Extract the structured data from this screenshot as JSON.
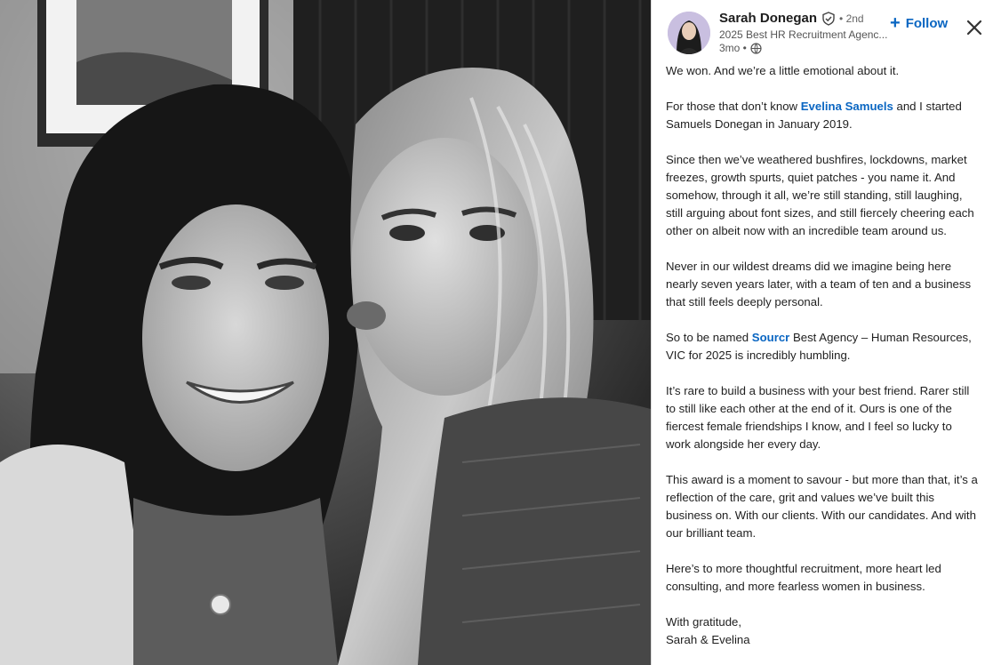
{
  "photo": {
    "alt": "Black and white selfie of two women"
  },
  "author": {
    "name": "Sarah Donegan",
    "degree": "• 2nd",
    "headline": "2025 Best HR Recruitment Agenc...",
    "time": "3mo •"
  },
  "follow": {
    "label": "Follow"
  },
  "icons": {
    "verified": "verified-shield-icon",
    "globe": "globe-icon",
    "close": "close-icon",
    "plus": "plus-icon"
  },
  "colors": {
    "link": "#0a66c2",
    "text": "#1f1f1f",
    "muted": "#666666"
  },
  "post": {
    "p1": "We won. And we’re a little emotional about it.",
    "p2_before": "For those that don’t know ",
    "p2_mention": "Evelina Samuels",
    "p2_after": " and I started Samuels Donegan in January 2019.",
    "p3": "Since then we’ve weathered bushfires, lockdowns, market freezes, growth spurts, quiet patches - you name it. And somehow, through it all, we’re still standing, still laughing, still arguing about font sizes, and still fiercely cheering each other on albeit now with an incredible team around us.",
    "p4": "Never in our wildest dreams did we imagine being here nearly seven years later, with a team of ten and a business that still feels deeply personal.",
    "p5_before": "So to be named ",
    "p5_mention": "Sourcr",
    "p5_after": " Best Agency – Human Resources, VIC for 2025 is incredibly humbling.",
    "p6": "It’s rare to build a business with your best friend. Rarer still to still like each other at the end of it. Ours is one of the fiercest female friendships I know, and I feel so lucky to work alongside her every day.",
    "p7": "This award is a moment to savour - but more than that, it’s a reflection of the care, grit and values we’ve built this business on. With our clients. With our candidates. And with our brilliant team.",
    "p8": "Here’s to more thoughtful recruitment, more heart led consulting, and more fearless women in business.",
    "p9": "With gratitude,",
    "p10": "Sarah & Evelina"
  }
}
